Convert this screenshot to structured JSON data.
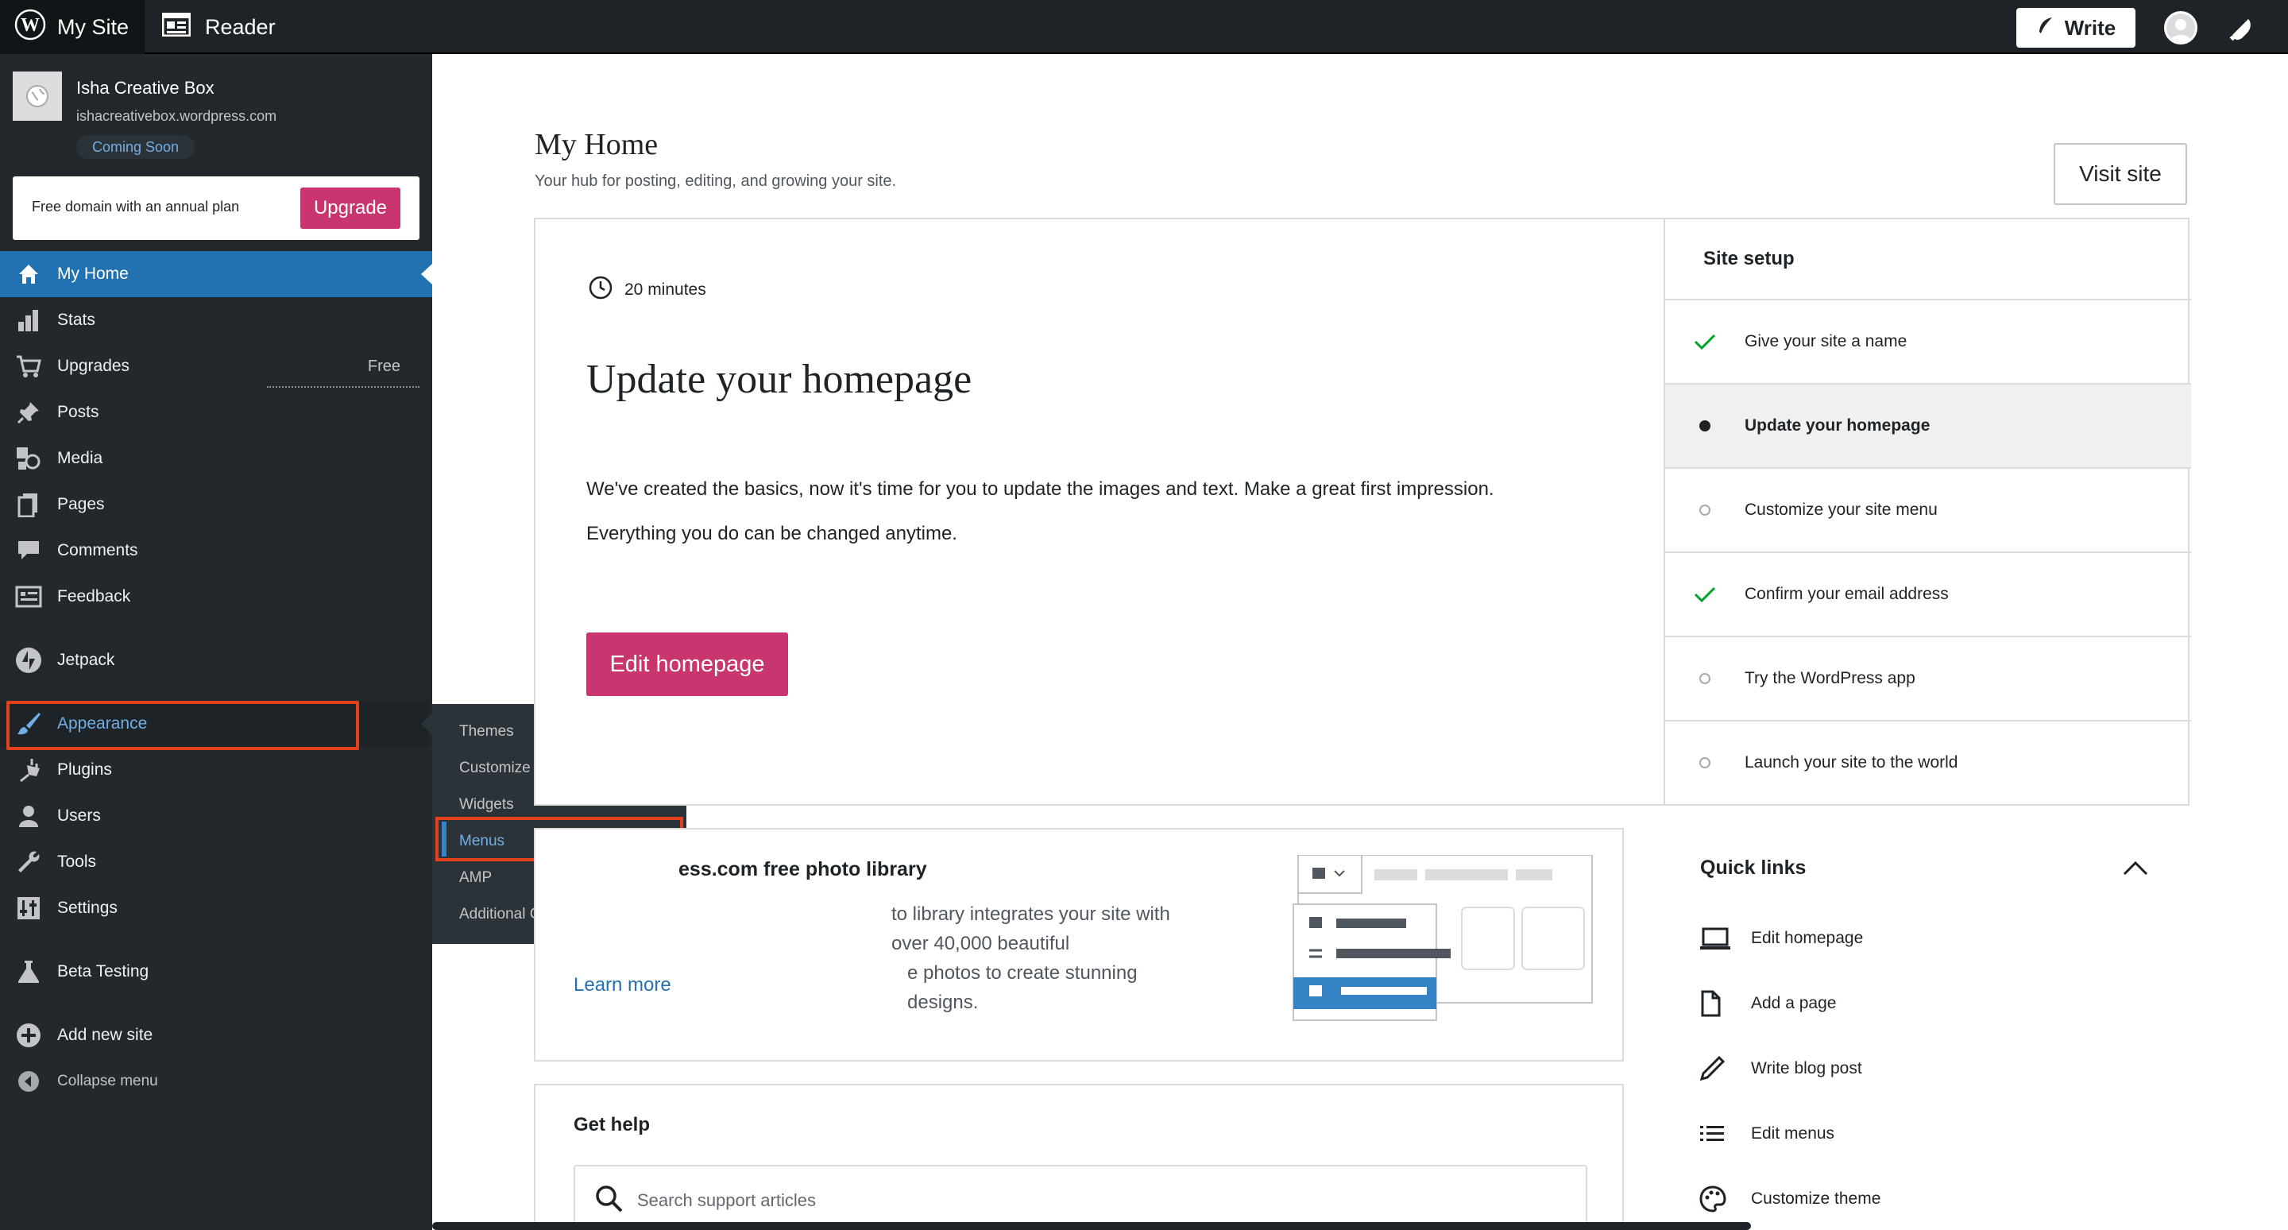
{
  "topbar": {
    "mysite_label": "My Site",
    "reader_label": "Reader",
    "write_label": "Write"
  },
  "site": {
    "name": "Isha Creative Box",
    "url": "ishacreativebox.wordpress.com",
    "badge": "Coming Soon"
  },
  "domain_banner": {
    "text": "Free domain with an annual plan",
    "button": "Upgrade"
  },
  "sidebar": {
    "items": [
      {
        "label": "My Home",
        "icon": "home-icon"
      },
      {
        "label": "Stats",
        "icon": "stats-icon"
      },
      {
        "label": "Upgrades",
        "icon": "cart-icon",
        "extra": "Free"
      },
      {
        "label": "Posts",
        "icon": "pin-icon"
      },
      {
        "label": "Media",
        "icon": "media-icon"
      },
      {
        "label": "Pages",
        "icon": "pages-icon"
      },
      {
        "label": "Comments",
        "icon": "comment-icon"
      },
      {
        "label": "Feedback",
        "icon": "feedback-icon"
      },
      {
        "label": "Jetpack",
        "icon": "jetpack-icon"
      },
      {
        "label": "Appearance",
        "icon": "brush-icon"
      },
      {
        "label": "Plugins",
        "icon": "plugin-icon"
      },
      {
        "label": "Users",
        "icon": "users-icon"
      },
      {
        "label": "Tools",
        "icon": "wrench-icon"
      },
      {
        "label": "Settings",
        "icon": "settings-icon"
      },
      {
        "label": "Beta Testing",
        "icon": "flask-icon"
      },
      {
        "label": "Add new site",
        "icon": "plus-circle-icon"
      },
      {
        "label": "Collapse menu",
        "icon": "collapse-icon"
      }
    ]
  },
  "flyout": {
    "items": [
      "Themes",
      "Customize",
      "Widgets",
      "Menus",
      "AMP",
      "Additional CSS"
    ]
  },
  "main": {
    "title": "My Home",
    "subtitle": "Your hub for posting, editing, and growing your site.",
    "visit_site": "Visit site"
  },
  "task": {
    "time": "20 minutes",
    "title": "Update your homepage",
    "desc1": "We've created the basics, now it's time for you to update the images and text. Make a great first impression.",
    "desc2": "Everything you do can be changed anytime.",
    "button": "Edit homepage"
  },
  "setup": {
    "title": "Site setup",
    "items": [
      {
        "label": "Give your site a name",
        "status": "done"
      },
      {
        "label": "Update your homepage",
        "status": "active"
      },
      {
        "label": "Customize your site menu",
        "status": "todo"
      },
      {
        "label": "Confirm your email address",
        "status": "done"
      },
      {
        "label": "Try the WordPress app",
        "status": "todo"
      },
      {
        "label": "Launch your site to the world",
        "status": "todo"
      }
    ]
  },
  "photo_card": {
    "title": "ess.com free photo library",
    "desc_line1": "to library integrates your site with over 40,000 beautiful",
    "desc_line2": "e photos to create stunning designs.",
    "learn_more": "Learn more"
  },
  "help": {
    "title": "Get help",
    "search_placeholder": "Search support articles"
  },
  "quick_links": {
    "title": "Quick links",
    "items": [
      {
        "label": "Edit homepage",
        "icon": "laptop-icon"
      },
      {
        "label": "Add a page",
        "icon": "page-icon"
      },
      {
        "label": "Write blog post",
        "icon": "pencil-icon"
      },
      {
        "label": "Edit menus",
        "icon": "list-icon"
      },
      {
        "label": "Customize theme",
        "icon": "palette-icon"
      }
    ]
  },
  "colors": {
    "accent": "#2271b1",
    "brand_pink": "#c9356e",
    "sidebar_bg": "#23282d",
    "highlight_box": "#e2401c"
  }
}
